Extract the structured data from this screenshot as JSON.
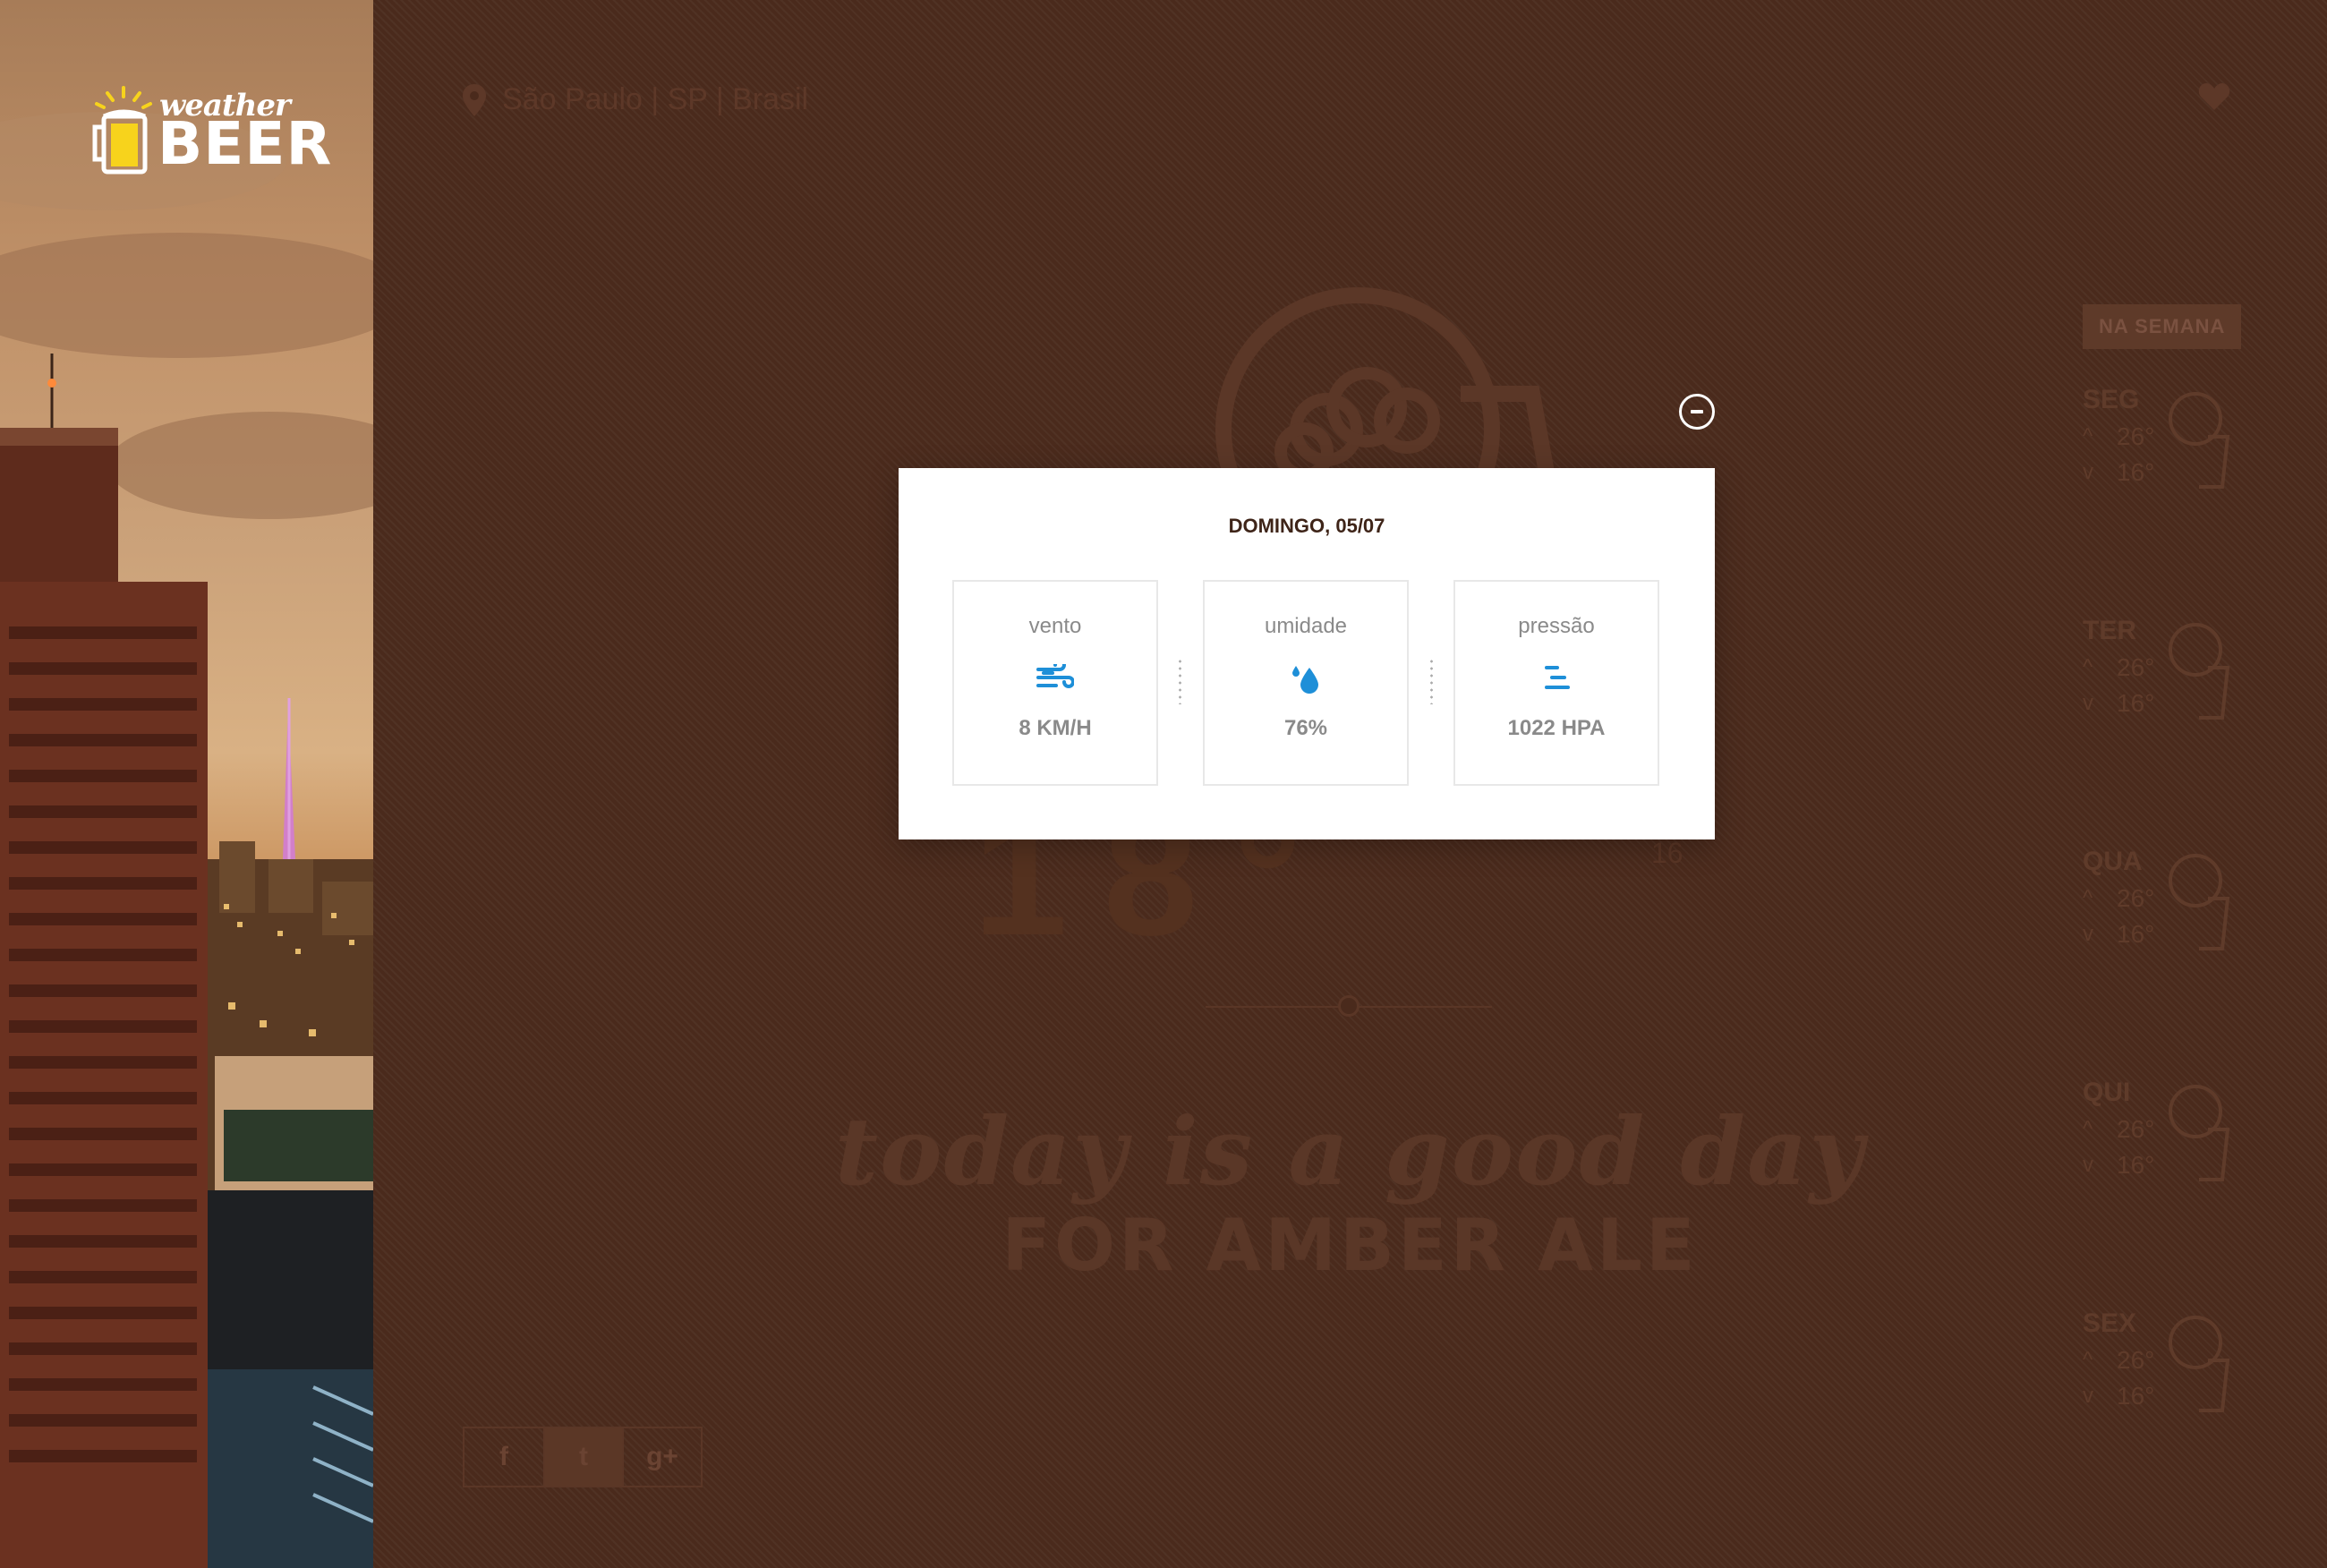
{
  "app": {
    "logo_top": "weather",
    "logo_bottom": "BEER"
  },
  "header": {
    "location": "São Paulo | SP | Brasil"
  },
  "modal": {
    "date": "DOMINGO, 05/07",
    "stats": [
      {
        "label": "vento",
        "value": "8 KM/H",
        "icon": "wind-icon"
      },
      {
        "label": "umidade",
        "value": "76%",
        "icon": "droplet-icon"
      },
      {
        "label": "pressão",
        "value": "1022 HPA",
        "icon": "pressure-icon"
      }
    ],
    "accent_color": "#1e8fd8"
  },
  "background": {
    "temperature": "18°",
    "small_value": "16",
    "tagline_1": "today is a good day",
    "tagline_2": "FOR AMBER ALE"
  },
  "week": {
    "badge": "NA SEMANA",
    "days": [
      {
        "name": "SEG",
        "max": "26°",
        "min": "16°"
      },
      {
        "name": "TER",
        "max": "26°",
        "min": "16°"
      },
      {
        "name": "QUA",
        "max": "26°",
        "min": "16°"
      },
      {
        "name": "QUI",
        "max": "26°",
        "min": "16°"
      },
      {
        "name": "SEX",
        "max": "26°",
        "min": "16°"
      }
    ]
  },
  "social": {
    "facebook": "f",
    "twitter": "t",
    "google": "g+"
  }
}
